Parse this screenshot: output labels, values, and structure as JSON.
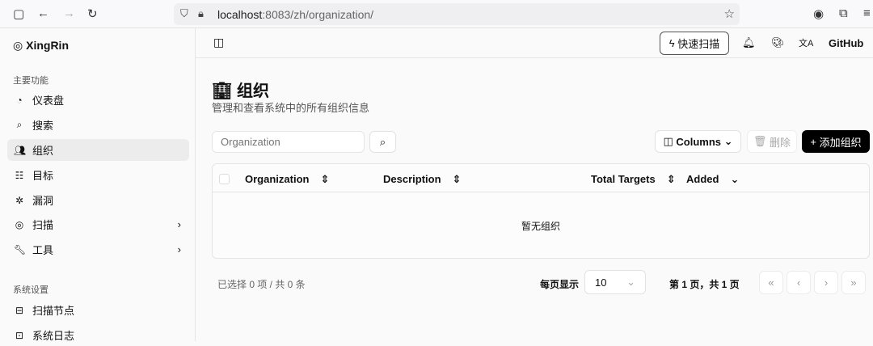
{
  "browser": {
    "url_host": "localhost",
    "url_path": ":8083/zh/organization/"
  },
  "sidebar": {
    "brand": "XingRin",
    "section_main": "主要功能",
    "items": [
      {
        "label": "仪表盘"
      },
      {
        "label": "搜索"
      },
      {
        "label": "组织"
      },
      {
        "label": "目标"
      },
      {
        "label": "漏洞"
      },
      {
        "label": "扫描"
      },
      {
        "label": "工具"
      }
    ],
    "section_settings": "系统设置",
    "settings_items": [
      {
        "label": "扫描节点"
      },
      {
        "label": "系统日志"
      }
    ]
  },
  "topbar": {
    "quick_scan": "快速扫描",
    "github": "GitHub"
  },
  "page": {
    "title": "组织",
    "subtitle": "管理和查看系统中的所有组织信息"
  },
  "toolbar": {
    "search_placeholder": "Organization",
    "columns": "Columns",
    "delete": "删除",
    "add": "添加组织"
  },
  "table": {
    "headers": [
      "Organization",
      "Description",
      "Total Targets",
      "Added"
    ],
    "empty": "暂无组织"
  },
  "footer": {
    "selection": "已选择 0 项 / 共 0 条",
    "per_page_label": "每页显示",
    "per_page": "10",
    "page_info": "第 1 页，共 1 页"
  }
}
